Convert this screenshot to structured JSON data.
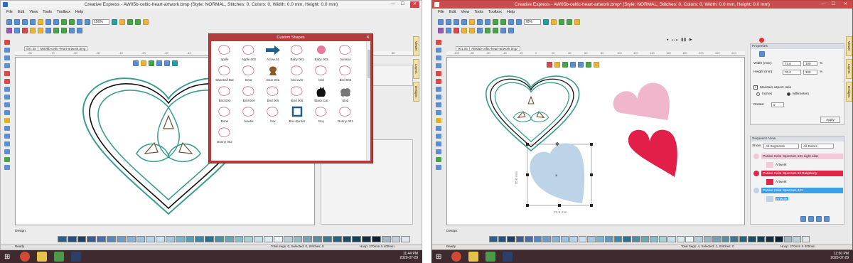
{
  "left": {
    "title": "Creative Express - AW05b-celtic-heart-artwork.bmp (Style: NORMAL, Stitches: 0, Colors: 0, Width: 0.0 mm, Height: 0.0 mm)",
    "menu": [
      "File",
      "Edit",
      "View",
      "Tools",
      "Toolbox",
      "Help"
    ],
    "zoom": "156%",
    "doc_tabs": [
      "001.05",
      "AW05b-celtic-heart-artwork.bmp"
    ],
    "ruler_ticks": [
      "-80",
      "-70",
      "-60",
      "-50",
      "-40",
      "-30",
      "-20",
      "-10",
      "0",
      "10",
      "20",
      "30",
      "40",
      "50",
      "60",
      "70",
      "80"
    ],
    "side_tabs": [
      "Viewer",
      "Layers",
      "Designs"
    ],
    "design_label": "Design:",
    "status": {
      "ready": "Ready",
      "segs": "Total Segs: 0, Selected: 0, Stitches: 0",
      "hoop": "Hoop: 270mm X 400mm"
    },
    "clock": {
      "time": "11:44 PM",
      "date": "2020-07-29"
    }
  },
  "dialog": {
    "title": "Custom Shapes",
    "shapes": [
      "apple",
      "Apple 002",
      "Arrow 01",
      "Baby 001",
      "Baby 003",
      "banana",
      "Baseball Bat",
      "Bear",
      "Bear 001",
      "bird ever",
      "bird",
      "Bird 002",
      "Bird 003",
      "Bird 004",
      "Bird 005",
      "Bird 006",
      "Black Cat",
      "blob",
      "Bone",
      "bowtie",
      "box",
      "Box-Border",
      "Boy",
      "Bunny 001",
      "Bunny 002"
    ]
  },
  "right": {
    "title": "Creative Express - AW05b-celtic-heart-artwork.bmp* (Style: NORMAL, Stitches: 0, Colors: 0, Width: 0.0 mm, Height: 0.0 mm)",
    "menu": [
      "File",
      "Edit",
      "View",
      "Tools",
      "Toolbox",
      "Help"
    ],
    "zoom": "78%",
    "page_counter": "1 / 0",
    "doc_tabs": [
      "001.05",
      "AW05b-celtic-heart-artwork.bmp*"
    ],
    "ruler_ticks": [
      "-100",
      "-80",
      "-60",
      "-40",
      "-20",
      "0",
      "20",
      "40",
      "60",
      "80",
      "100",
      "120",
      "140",
      "160",
      "180",
      "200",
      "220",
      "240"
    ],
    "side_tabs": [
      "Viewer",
      "Layers",
      "Designs"
    ],
    "selection": {
      "width": "73.6 mm",
      "height": "70.0 mm"
    },
    "properties": {
      "header": "Properties",
      "width_label": "Width (mm):",
      "width_value": "73.6",
      "width_pct": "100",
      "height_label": "Height (mm):",
      "height_value": "70.0",
      "height_pct": "100",
      "pct_sign": "%",
      "aspect_label": "Maintain aspect ratio",
      "inches": "Inches",
      "millimeters": "Millimeters",
      "rotate_label": "Rotate:",
      "rotate_value": "0",
      "apply": "Apply"
    },
    "sequence": {
      "header": "Sequence View",
      "show_label": "Show:",
      "segments": "All Segments",
      "colors": "All Colors",
      "rows": [
        {
          "label": "Poriani Color Spectrum 131 Light Lilac",
          "color": "#f2c9d9",
          "artwork": "Artwork"
        },
        {
          "label": "Poriani Color Spectrum 83 Raspberry",
          "color": "#e0254a",
          "artwork": "Artwork"
        },
        {
          "label": "Poriani Color Spectrum 331",
          "color": "#3aa0e8",
          "artwork": "Artwork"
        }
      ]
    },
    "design_label": "Design:",
    "status": {
      "ready": "Ready",
      "segs": "Total Segs: 4, Selected: 1, Stitches: 0",
      "hoop": "Hoop: 270mm X 400mm"
    },
    "clock": {
      "time": "11:50 PM",
      "date": "2020-07-29"
    }
  },
  "colors": {
    "heart_pink": "#efb6cc",
    "heart_red": "#e21f48",
    "heart_blue": "#bcd3e8",
    "celtic_teal": "#3a9c8f",
    "arrow_blue": "#1b5f8e"
  },
  "palette": [
    "#2d5f8a",
    "#2a4f7a",
    "#1e4266",
    "#395d8f",
    "#4b6ea6",
    "#5a86b5",
    "#6f9cc6",
    "#86b2d6",
    "#9cc4e2",
    "#b3d5ec",
    "#c9e2f2",
    "#a6c8de",
    "#7fb0cc",
    "#5f9bb8",
    "#3f87a4",
    "#2a7390",
    "#4e8ea2",
    "#6aa6b6",
    "#88bcc8",
    "#a7d0d8",
    "#c4e3e8",
    "#d8ecef",
    "#e9f4f6",
    "#b9cfd8",
    "#98b8c6",
    "#7aa2b4",
    "#5c8ca2",
    "#3f7690",
    "#2a617c",
    "#1c4d68",
    "#163f58",
    "#122f44",
    "#0e2234",
    "#a3b9c5",
    "#c1d1da",
    "#dfe8ed"
  ]
}
